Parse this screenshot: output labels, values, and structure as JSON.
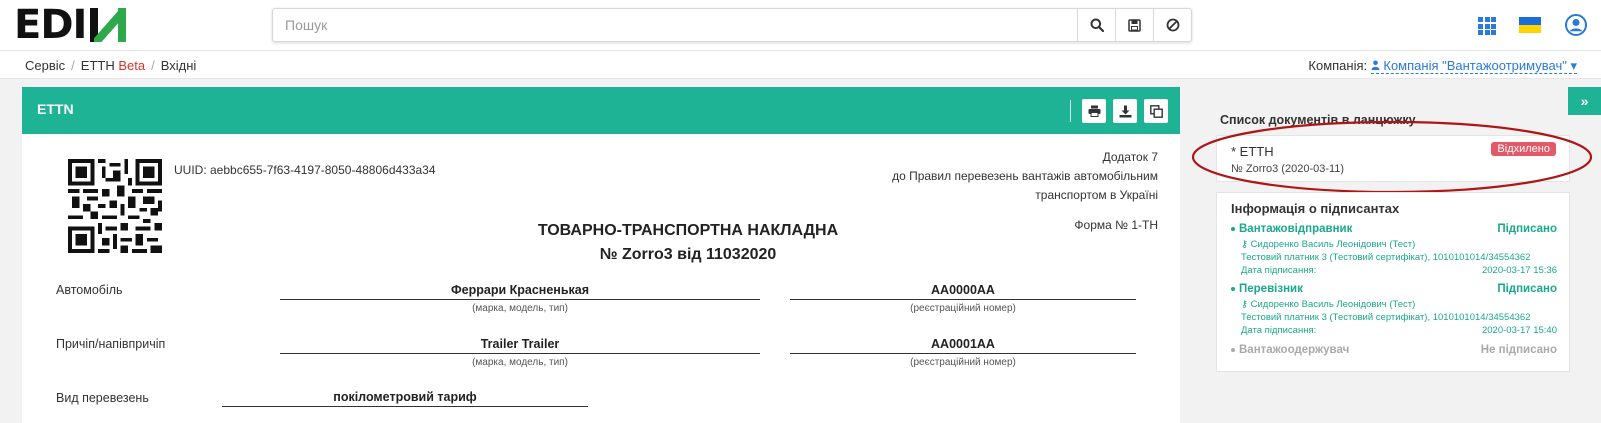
{
  "header": {
    "logo_text": "EDIN",
    "search": {
      "placeholder": "Пошук",
      "value": ""
    },
    "icons": [
      "search-icon",
      "save-icon",
      "ban-icon",
      "apps-grid-icon",
      "ukraine-flag-icon",
      "user-icon"
    ]
  },
  "breadcrumb": {
    "items": [
      "Сервіс",
      "ЕТТН",
      "Вхідні"
    ],
    "beta": "Beta"
  },
  "company": {
    "label": "Компанія:",
    "name": "Компанія \"Вантажоотримувач\""
  },
  "card": {
    "title": "ETTN",
    "tools": [
      "print-icon",
      "download-icon",
      "copy-icon"
    ]
  },
  "document": {
    "uuid": "UUID: aebbc655-7f63-4197-8050-48806d433a34",
    "appendix_line1": "Додаток 7",
    "appendix_line2": "до Правил перевезень вантажів автомобільним",
    "appendix_line3": "транспортом в Україні",
    "form": "Форма № 1-ТН",
    "title_line1": "ТОВАРНО-ТРАНСПОРТНА НАКЛАДНА",
    "title_line2": "№ Zorro3 від 11032020",
    "rows": [
      {
        "label": "Автомобіль",
        "model": "Феррари Красненькая",
        "model_hint": "(марка, модель, тип)",
        "reg": "AA0000AA",
        "reg_hint": "(реєстраційний номер)"
      },
      {
        "label": "Причіп/напівпричіп",
        "model": "Trailer Trailer",
        "model_hint": "(марка, модель, тип)",
        "reg": "AA0001AA",
        "reg_hint": "(реєстраційний номер)"
      }
    ],
    "transport_type_label": "Вид перевезень",
    "transport_type_value": "покілометровий тариф"
  },
  "sidebar": {
    "expand_label": "»",
    "chain_title": "Список документів в ланцюжку",
    "chain_items": [
      {
        "name": "* ЕТТН",
        "number": "№ Zorro3 (2020-03-11)",
        "status": "Відхилено",
        "status_color": "#e25a67"
      }
    ],
    "signers_title": "Інформація о підписантах",
    "signers": [
      {
        "role": "Вантажовідправник",
        "status": "Підписано",
        "person": "Сидоренко Василь Леонідович (Тест)",
        "cert": "Тестовий платник 3 (Тестовий сертифікат), 1010101014/34554362",
        "date_label": "Дата підписання:",
        "date": "2020-03-17 15:36"
      },
      {
        "role": "Перевізник",
        "status": "Підписано",
        "person": "Сидоренко Василь Леонідович (Тест)",
        "cert": "Тестовий платник 3 (Тестовий сертифікат), 1010101014/34554362",
        "date_label": "Дата підписання:",
        "date": "2020-03-17 15:40"
      },
      {
        "role": "Вантажоодержувач",
        "status": "Не підписано"
      }
    ],
    "accent_color": "#1aa98a"
  },
  "colors": {
    "primary": "#1db394",
    "link": "#2a7ad9",
    "danger": "#e25a67",
    "annotation": "#b01515"
  }
}
